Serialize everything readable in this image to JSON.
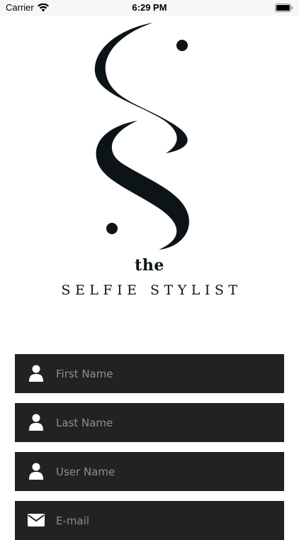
{
  "status_bar": {
    "carrier": "Carrier",
    "time": "6:29 PM"
  },
  "brand": {
    "the": "the",
    "name": "SELFIE STYLIST",
    "logo_color": "#0d1418"
  },
  "form": {
    "fields": [
      {
        "placeholder": "First Name",
        "value": "",
        "icon": "user-icon"
      },
      {
        "placeholder": "Last Name",
        "value": "",
        "icon": "user-icon"
      },
      {
        "placeholder": "User Name",
        "value": "",
        "icon": "user-icon"
      },
      {
        "placeholder": "E-mail",
        "value": "",
        "icon": "envelope-icon"
      }
    ],
    "field_background": "#222222",
    "placeholder_color": "#8f8f8f"
  }
}
